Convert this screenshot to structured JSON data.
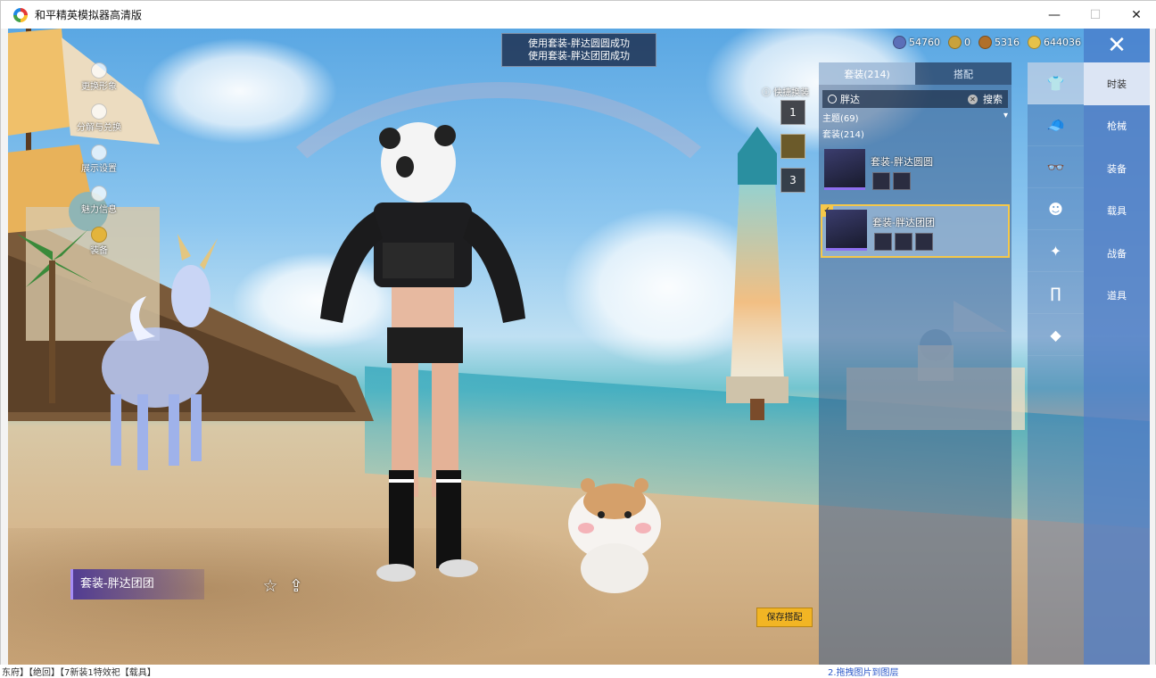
{
  "window": {
    "title": "和平精英模拟器高清版",
    "minimize": "—",
    "maximize": "☐",
    "close": "✕"
  },
  "toast": {
    "line1": "使用套装-胖达圆圆成功",
    "line2": "使用套装-胖达团团成功"
  },
  "left_menu": [
    {
      "label": "更换形象",
      "icon": "person-icon"
    },
    {
      "label": "分解与兑换",
      "icon": "gear-icon"
    },
    {
      "label": "展示设置",
      "icon": "eye-icon"
    },
    {
      "label": "魅力信息",
      "icon": "charm-icon"
    },
    {
      "label": "装备",
      "icon": "equip-icon"
    }
  ],
  "currency": [
    {
      "icon": "diamond-coin-icon",
      "value": "54760",
      "color": "#5b6fb8"
    },
    {
      "icon": "gold-ring-coin-icon",
      "value": "0",
      "color": "#c9a23c"
    },
    {
      "icon": "bronze-coin-icon",
      "value": "5316",
      "color": "#b0702b"
    },
    {
      "icon": "star-coin-icon",
      "value": "644036",
      "color": "#e6c24a"
    }
  ],
  "close_game": "✕",
  "quick_swap": {
    "label": "快捷换装",
    "slots": [
      "1",
      "",
      "3"
    ]
  },
  "panel": {
    "tabs": [
      "套装(214)",
      "搭配"
    ],
    "search_value": "胖达",
    "search_button": "搜索",
    "theme_label": "主题(69)",
    "suit_label": "套装(214)",
    "items": [
      {
        "name": "套装-胖达圆圆",
        "selected": false
      },
      {
        "name": "套装-胖达团团",
        "selected": true
      }
    ]
  },
  "icon_column": [
    "outfit-icon",
    "hat-icon",
    "glasses-icon",
    "mask-icon",
    "top-icon",
    "pants-icon",
    "shoes-icon"
  ],
  "categories": [
    "时装",
    "枪械",
    "装备",
    "载具",
    "战备",
    "道具"
  ],
  "outfit_label": "套装-胖达团团",
  "save_button": "保存搭配",
  "bottom": {
    "left": "东府】【绝回】【7新装1特效祀【载具】",
    "right": "2.拖拽图片到图层"
  },
  "accent": "#f2b524"
}
